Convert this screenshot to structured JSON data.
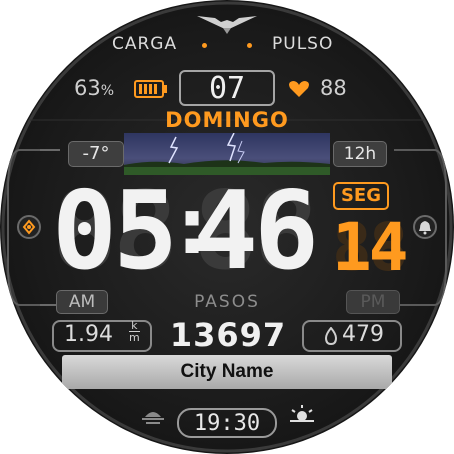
{
  "top": {
    "left_label": "CARGA",
    "right_label": "PULSO"
  },
  "battery": {
    "percent": "63",
    "unit": "%",
    "level": 0.63
  },
  "date": {
    "day_number": "07",
    "day_name": "DOMINGO"
  },
  "heart": {
    "bpm": "88"
  },
  "weather": {
    "temperature": "-7°"
  },
  "format": {
    "label": "12h"
  },
  "time": {
    "hours": "05",
    "separator": ":",
    "minutes": "46",
    "ghost": "88",
    "seconds_label": "SEG",
    "seconds": "14"
  },
  "ampm": {
    "am": "AM",
    "pm": "PM"
  },
  "steps": {
    "label": "PASOS",
    "value": "13697"
  },
  "distance": {
    "value": "1.94",
    "unit_top": "k",
    "unit_bottom": "m"
  },
  "calories": {
    "value": "479"
  },
  "location": {
    "city": "City Name"
  },
  "sun": {
    "time": "19:30"
  },
  "colors": {
    "accent": "#ff9a1f",
    "background": "#1a1a1a",
    "text": "#e6e6e6"
  }
}
